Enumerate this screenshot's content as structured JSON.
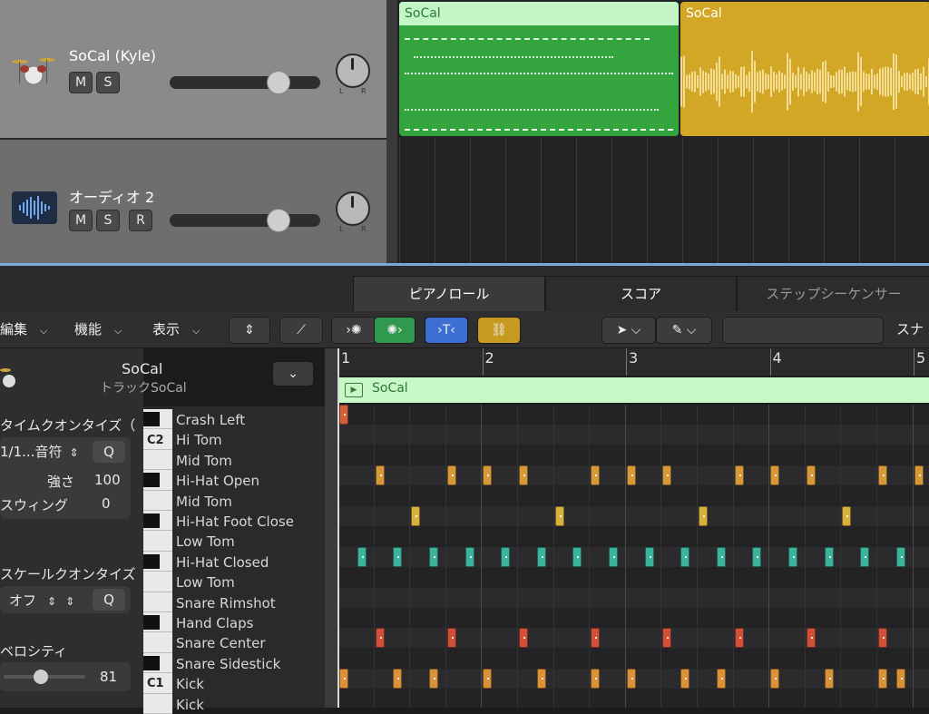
{
  "tracks": [
    {
      "name": "SoCal (Kyle)",
      "buttons": [
        "M",
        "S"
      ],
      "volume": 0.7,
      "icon": "drum-kit-icon"
    },
    {
      "name": "オーディオ 2",
      "buttons": [
        "M",
        "S",
        "R"
      ],
      "volume": 0.7,
      "icon": "audio-waveform-icon"
    }
  ],
  "pan": {
    "l": "L",
    "r": "R"
  },
  "regions": {
    "green": "SoCal",
    "gold": "SoCal"
  },
  "tabs": [
    "ピアノロール",
    "スコア",
    "ステップシーケンサー"
  ],
  "toolbar": {
    "edit": "編集",
    "functions": "機能",
    "view": "表示",
    "cut_off": "スナ"
  },
  "inspector": {
    "track_title": "SoCal",
    "track_sub": "トラックSoCal",
    "time_quantize": "タイムクオンタイズ（",
    "quant_value": "1/1...音符",
    "q": "Q",
    "strength_label": "強さ",
    "strength_value": "100",
    "swing_label": "スウィング",
    "swing_value": "0",
    "scale_quantize": "スケールクオンタイズ",
    "scale_value": "オフ",
    "velocity_label": "ベロシティ",
    "velocity_value": "81",
    "velocity_level": 0.46
  },
  "ruler": {
    "bars": [
      "1",
      "2",
      "3",
      "4",
      "5"
    ]
  },
  "roll_region_name": "SoCal",
  "drums": [
    "Crash Left",
    "Hi Tom",
    "Mid Tom",
    "Hi-Hat Open",
    "Mid Tom",
    "Hi-Hat Foot Close",
    "Low Tom",
    "Hi-Hat Closed",
    "Low Tom",
    "Snare Rimshot",
    "Hand Claps",
    "Snare Center",
    "Snare Sidestick",
    "Kick",
    "Kick"
  ],
  "octave_labels": {
    "c2": "C2",
    "c1": "C1"
  },
  "colors": {
    "region_green": "#34a43f",
    "region_gold": "#d2a726",
    "accent_blue": "#3d6fd3",
    "accent_gold": "#c69a1f"
  },
  "notes": [
    {
      "lane": 0,
      "beats": [
        0
      ],
      "color": "#d2603a"
    },
    {
      "lane": 3,
      "beats": [
        1,
        3,
        4,
        5,
        7,
        8,
        9,
        11,
        12,
        13,
        15,
        16
      ],
      "color": "#d79a3a"
    },
    {
      "lane": 5,
      "beats": [
        2,
        6,
        10,
        14
      ],
      "color": "#d9b23c"
    },
    {
      "lane": 7,
      "beats": [
        0.5,
        1.5,
        2.5,
        3.5,
        4.5,
        5.5,
        6.5,
        7.5,
        8.5,
        9.5,
        10.5,
        11.5,
        12.5,
        13.5,
        14.5,
        15.5
      ],
      "color": "#3cb39a"
    },
    {
      "lane": 11,
      "beats": [
        1,
        3,
        5,
        7,
        9,
        11,
        13,
        15
      ],
      "color": "#d0503a"
    },
    {
      "lane": 13,
      "beats": [
        0,
        1.5,
        2.5,
        4,
        5.5,
        7,
        8,
        9.5,
        10.5,
        12,
        13.5,
        15,
        15.5
      ],
      "color": "#d9913a"
    }
  ]
}
